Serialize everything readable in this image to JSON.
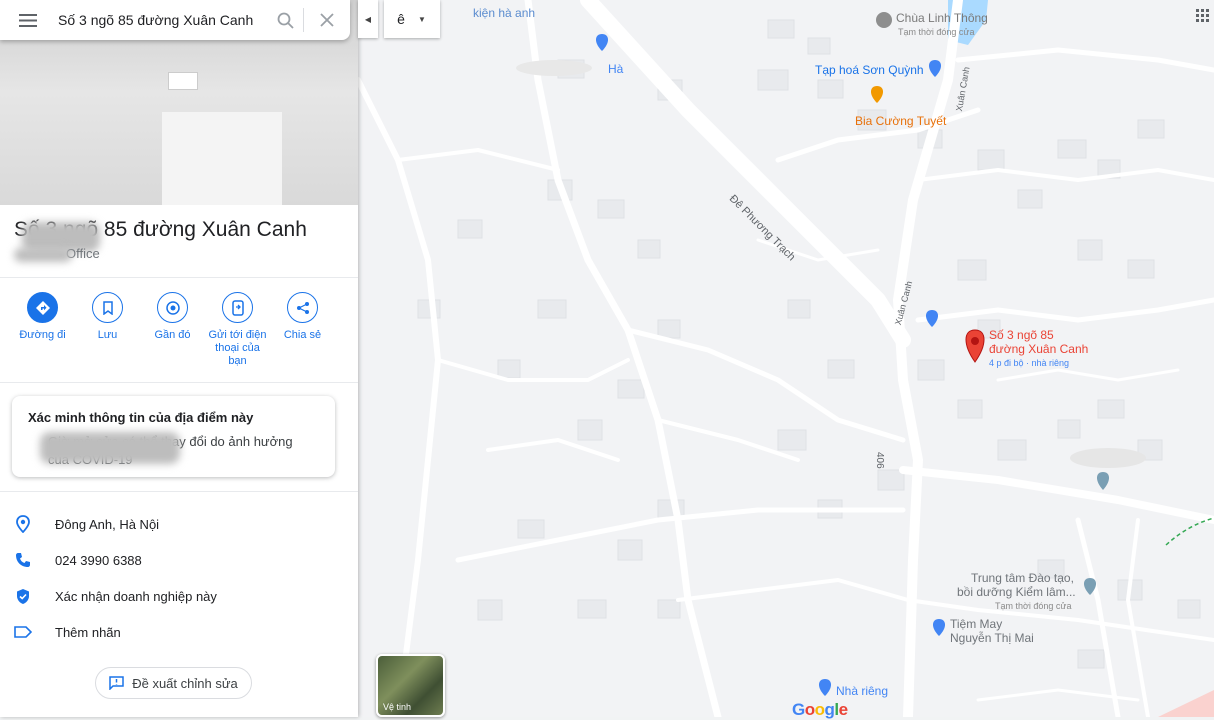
{
  "search": {
    "value": "Số 3 ngõ 85 đường Xuân Canh"
  },
  "layer_toggle": {
    "label": "ê"
  },
  "place": {
    "title": "Số 3 ngõ 85 đường Xuân Canh",
    "subtitle": "Office"
  },
  "actions": [
    {
      "label": "Đường đi",
      "icon": "directions-icon"
    },
    {
      "label": "Lưu",
      "icon": "bookmark-icon"
    },
    {
      "label": "Gần đó",
      "icon": "nearby-icon"
    },
    {
      "label": "Gửi tới điện thoại của bạn",
      "icon": "send-to-phone-icon"
    },
    {
      "label": "Chia sẻ",
      "icon": "share-icon"
    }
  ],
  "card": {
    "title": "Xác minh thông tin của địa điểm này",
    "body": "Giờ mở cửa có thể thay đổi do ảnh hưởng của COVID-19"
  },
  "info": {
    "address": "Đông Anh, Hà Nội",
    "phone": "024 3990 6388",
    "claim": "Xác nhận doanh nghiệp này",
    "label": "Thêm nhãn"
  },
  "suggest_edit": "Đề xuất chỉnh sửa",
  "map": {
    "road_label_1": "Đê Phương Trạch",
    "road_label_2": "Xuân Canh",
    "road_label_3": "406",
    "road_label_4": "Xuân Canh",
    "poi_chua_linh_thong": "Chùa Linh Thông",
    "poi_chua_linh_thong_status": "Tạm thời đóng cửa",
    "poi_tap_hoa": "Tạp hoá Sơn Quỳnh",
    "poi_bia": "Bia Cường Tuyết",
    "poi_top_left": "kiện hà anh",
    "poi_ha": "Hà",
    "marker_name_1": "Số 3 ngõ 85",
    "marker_name_2": "đường Xuân Canh",
    "marker_sub": "4 p đi bộ · nhà riêng",
    "poi_trung_tam_1": "Trung tâm Đào tạo,",
    "poi_trung_tam_2": "bồi dưỡng Kiểm lâm...",
    "poi_trung_tam_status": "Tạm thời đóng cửa",
    "poi_tiem_may_1": "Tiệm May",
    "poi_tiem_may_2": "Nguyễn Thị Mai",
    "poi_nha_rieng": "Nhà riêng",
    "satellite_label": "Vệ tinh",
    "logo": "Google",
    "colors": {
      "road": "#ffffff",
      "land": "#f2f3f5",
      "water": "#aadaff",
      "marker": "#ea4335",
      "poi_blue": "#4285f4",
      "poi_orange": "#f29900"
    }
  }
}
